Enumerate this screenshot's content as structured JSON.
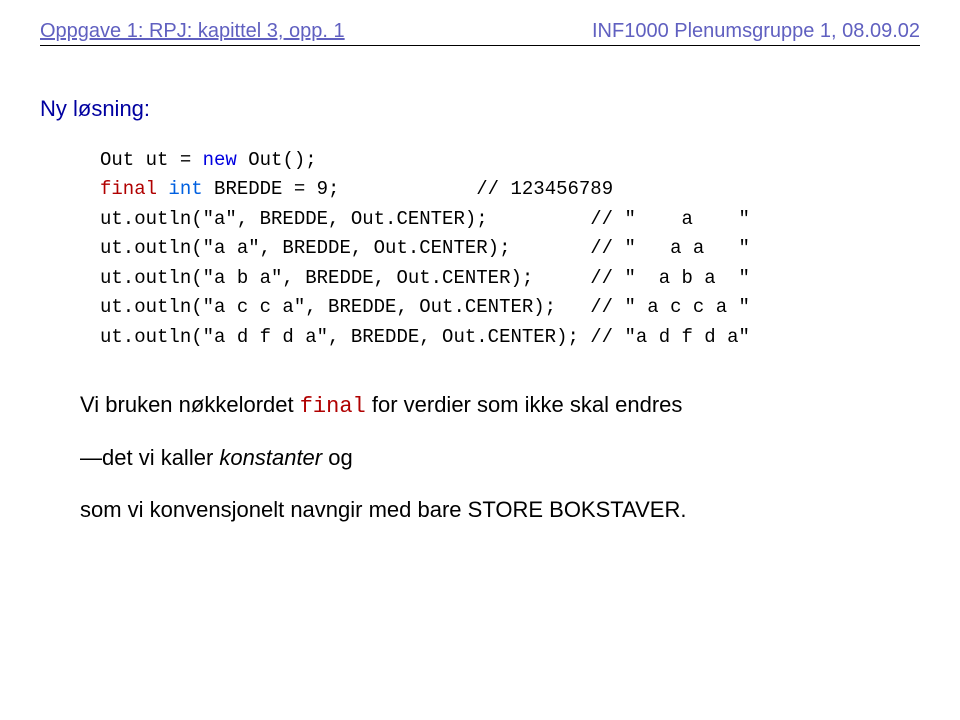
{
  "header": {
    "left": "Oppgave 1: RPJ: kapittel 3, opp. 1",
    "right": "INF1000 Plenumsgruppe 1, 08.09.02"
  },
  "solution_label": "Ny løsning:",
  "code": {
    "l1_a": "Out ut = ",
    "l1_new": "new",
    "l1_b": " Out();",
    "l2_final": "final",
    "l2_sp": " ",
    "l2_int": "int",
    "l2_b": " BREDDE = 9;            // 123456789",
    "l3": "ut.outln(\"a\", BREDDE, Out.CENTER);         // \"    a    \"",
    "l4": "ut.outln(\"a a\", BREDDE, Out.CENTER);       // \"   a a   \"",
    "l5": "ut.outln(\"a b a\", BREDDE, Out.CENTER);     // \"  a b a  \"",
    "l6": "ut.outln(\"a c c a\", BREDDE, Out.CENTER);   // \" a c c a \"",
    "l7": "ut.outln(\"a d f d a\", BREDDE, Out.CENTER); // \"a d f d a\""
  },
  "para1_a": "Vi bruken nøkkelordet ",
  "para1_final": "final",
  "para1_b": " for verdier som ikke skal endres",
  "para2_a": "—det vi kaller ",
  "para2_ital": "konstanter ",
  "para2_b": "og",
  "para3": "som vi konvensjonelt navngir med bare STORE BOKSTAVER."
}
